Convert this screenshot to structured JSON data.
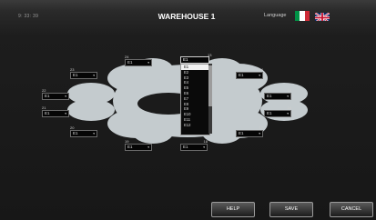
{
  "header": {
    "clock": "9: 33: 39",
    "title": "WAREHOUSE 1",
    "language_label": "Language",
    "flags": [
      {
        "name": "italian-flag",
        "colors": [
          "#009246",
          "#ffffff",
          "#ce2b37"
        ]
      },
      {
        "name": "uk-flag",
        "colors": [
          "#012169",
          "#ffffff",
          "#c8102e"
        ]
      }
    ]
  },
  "slots": [
    {
      "num": "24",
      "value": "E1"
    },
    {
      "num": "13",
      "value": "E1"
    },
    {
      "num": "23",
      "value": "E1"
    },
    {
      "num": "14",
      "value": "E1"
    },
    {
      "num": "22",
      "value": "E1"
    },
    {
      "num": "15",
      "value": "E1"
    },
    {
      "num": "21",
      "value": "E1"
    },
    {
      "num": "16",
      "value": "E1"
    },
    {
      "num": "20",
      "value": "E1"
    },
    {
      "num": "17",
      "value": "E1"
    },
    {
      "num": "19",
      "value": "E1"
    },
    {
      "num": "18",
      "value": "E1"
    }
  ],
  "dropdown": {
    "options": [
      "E1",
      "E2",
      "E3",
      "E4",
      "E5",
      "E6",
      "E7",
      "E8",
      "E9",
      "E10",
      "E11",
      "E12"
    ],
    "selected_index": 0
  },
  "buttons": {
    "help": "HELP",
    "save": "SAVE",
    "cancel": "CANCEL"
  },
  "colors": {
    "shape_fill": "#c4cbce",
    "shape_cutout": "#1b1b1b",
    "button_border": "#9a9a9a"
  }
}
